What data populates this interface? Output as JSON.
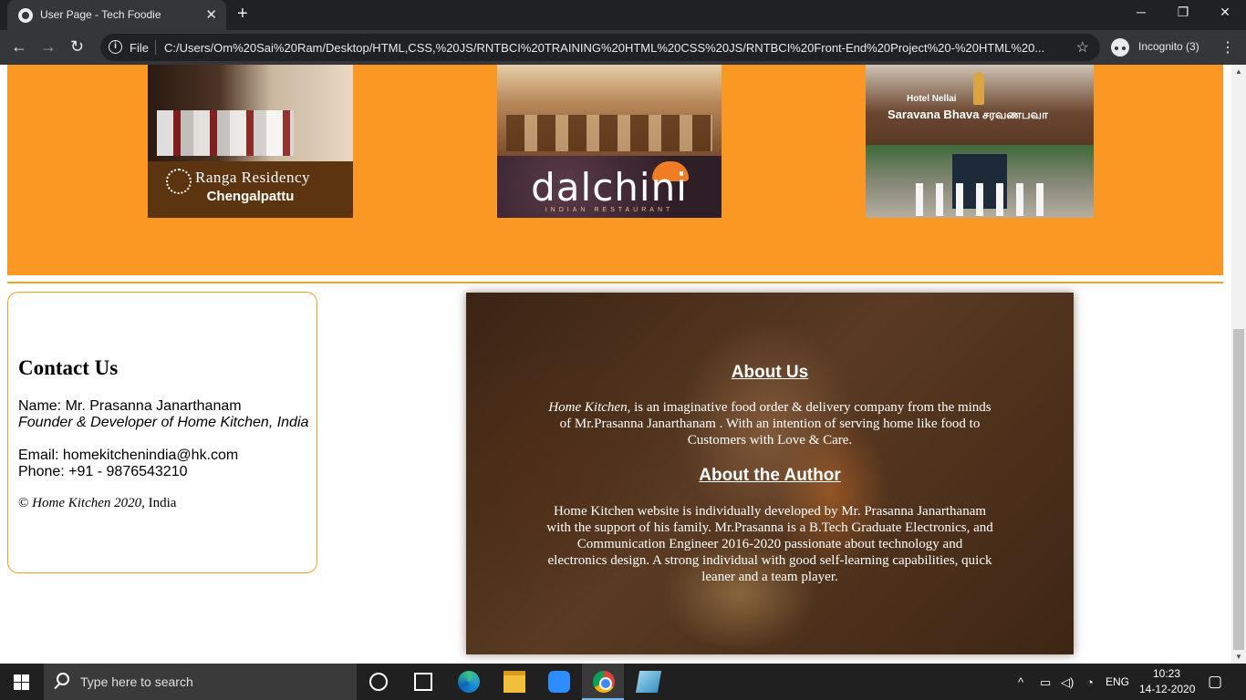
{
  "browser": {
    "tab_title": "User Page - Tech Foodie",
    "tab_close": "✕",
    "new_tab": "+",
    "file_label": "File",
    "url": "C:/Users/Om%20Sai%20Ram/Desktop/HTML,CSS,%20JS/RNTBCI%20TRAINING%20HTML%20CSS%20JS/RNTBCI%20Front-End%20Project%20-%20HTML%20...",
    "incognito_label": "Incognito (3)",
    "minimize": "─",
    "restore": "❐",
    "close": "✕",
    "back": "←",
    "forward": "→",
    "reload": "↻",
    "star": "☆",
    "menu": "⋮"
  },
  "restaurants": [
    {
      "name": "Ranga Residency",
      "subtitle": "Chengalpattu"
    },
    {
      "name": "dalchini",
      "tagline": "INDIAN RESTAURANT"
    },
    {
      "name_line1": "Hotel Nellai",
      "name_line2": "Saravana Bhava",
      "name_tamil": "சரவணபவா"
    }
  ],
  "contact": {
    "title": "Contact Us",
    "name": "Name: Mr. Prasanna Janarthanam",
    "role": "Founder & Developer of Home Kitchen, India",
    "email": "Email: homekitchenindia@hk.com",
    "phone": "Phone: +91 - 9876543210",
    "copyright_symbol": "©",
    "copyright_italic": "Home Kitchen 2020",
    "copyright_rest": ", India"
  },
  "about": {
    "heading": "About Us",
    "brand": "Home Kitchen",
    "text": ", is an imaginative food order & delivery company from the minds of Mr.Prasanna Janarthanam . With an intention of serving home like food to Customers with Love & Care.",
    "author_heading": "About the Author",
    "author_text": "Home Kitchen website is individually developed by Mr. Prasanna Janarthanam with the support of his family. Mr.Prasanna is a B.Tech Graduate Electronics, and Communication Engineer 2016-2020 passionate about technology and electronics design. A strong individual with good self-learning capabilities, quick leaner and a team player."
  },
  "taskbar": {
    "search_placeholder": "Type here to search",
    "language": "ENG",
    "time": "10:23",
    "date": "14-12-2020",
    "icons": [
      "windows-start-icon",
      "cortana-icon",
      "task-view-icon",
      "edge-icon",
      "file-explorer-icon",
      "zoom-icon",
      "chrome-icon",
      "notes-icon"
    ]
  }
}
